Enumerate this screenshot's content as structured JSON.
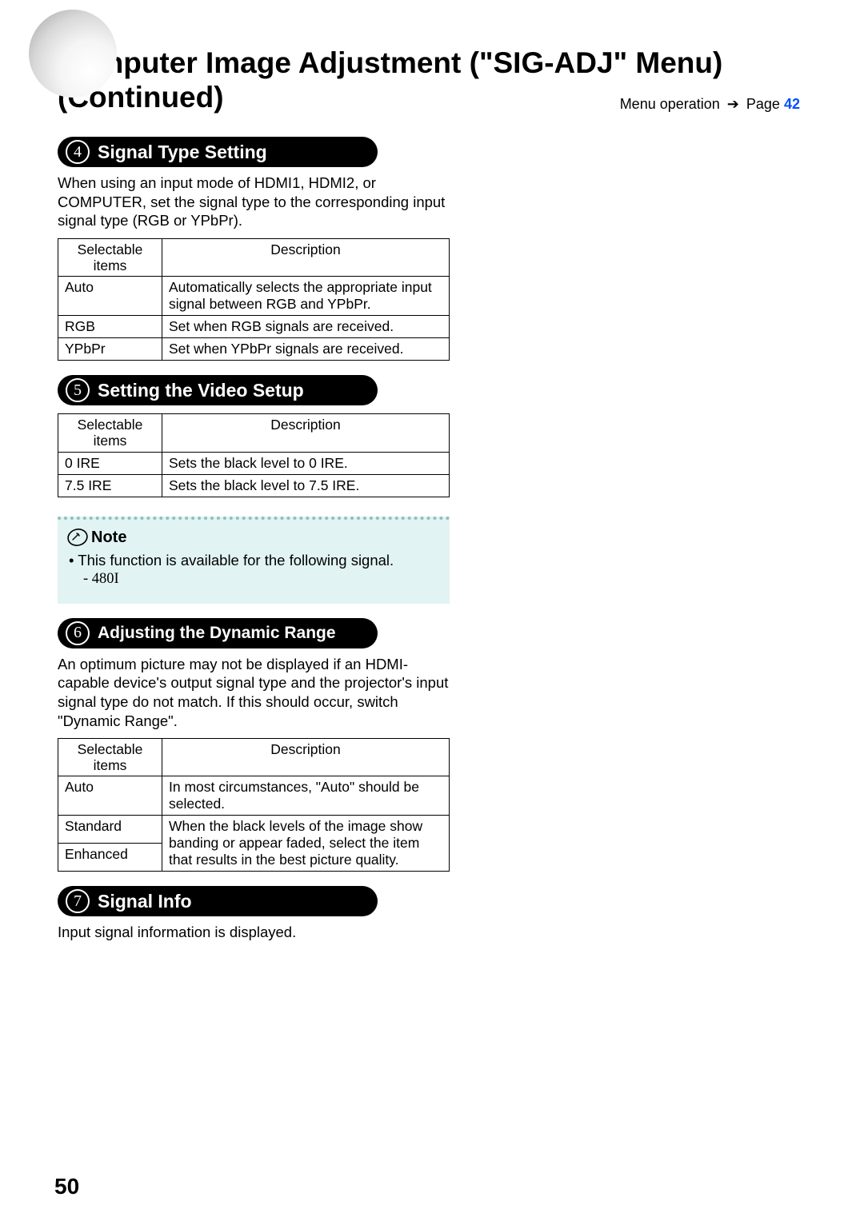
{
  "title": "Computer Image Adjustment (\"SIG-ADJ\" Menu) (Continued)",
  "menu_ref": {
    "text": "Menu operation",
    "page_label": "Page",
    "page_num": "42"
  },
  "s4": {
    "num": "4",
    "heading": "Signal Type Setting",
    "intro": "When using an input mode of HDMI1, HDMI2, or COMPUTER, set the signal type to the corresponding input signal type (RGB or YPbPr).",
    "th_items": "Selectable items",
    "th_desc": "Description",
    "rows": [
      {
        "item": "Auto",
        "desc": "Automatically selects the appropriate input signal between RGB and YPbPr."
      },
      {
        "item": "RGB",
        "desc": "Set when RGB signals are received."
      },
      {
        "item": "YPbPr",
        "desc": "Set when YPbPr signals are received."
      }
    ]
  },
  "s5": {
    "num": "5",
    "heading": "Setting the Video Setup",
    "th_items": "Selectable items",
    "th_desc": "Description",
    "rows": [
      {
        "item": "0 IRE",
        "desc": "Sets the black level to 0 IRE."
      },
      {
        "item": "7.5 IRE",
        "desc": "Sets the black level to 7.5 IRE."
      }
    ]
  },
  "note": {
    "label": "Note",
    "line1": "This function is available for the following signal.",
    "line2": "480I"
  },
  "s6": {
    "num": "6",
    "heading": "Adjusting the Dynamic Range",
    "intro": "An optimum picture may not be displayed if an HDMI-capable device's output signal type and the projector's input signal type do not match. If this should occur, switch \"Dynamic Range\".",
    "th_items": "Selectable items",
    "th_desc": "Description",
    "row1": {
      "item": "Auto",
      "desc": "In most circumstances, \"Auto\" should be selected."
    },
    "row2_item": "Standard",
    "row3_item": "Enhanced",
    "row23_desc": "When the black levels of the image show banding or appear faded, select the item that results in the best picture quality."
  },
  "s7": {
    "num": "7",
    "heading": "Signal Info",
    "intro": "Input signal information is displayed."
  },
  "page_number": "50"
}
